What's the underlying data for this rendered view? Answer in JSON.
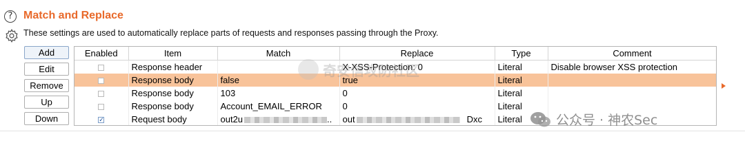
{
  "header": {
    "help_glyph": "?",
    "title": "Match and Replace",
    "description": "These settings are used to automatically replace parts of requests and responses passing through the Proxy."
  },
  "buttons": {
    "add": "Add",
    "edit": "Edit",
    "remove": "Remove",
    "up": "Up",
    "down": "Down"
  },
  "table": {
    "columns": [
      "Enabled",
      "Item",
      "Match",
      "Replace",
      "Type",
      "Comment"
    ],
    "selected_row": 1,
    "rows": [
      {
        "enabled": false,
        "item": "Response header",
        "match": "",
        "replace": "X-XSS-Protection: 0",
        "type": "Literal",
        "comment": "Disable browser XSS protection"
      },
      {
        "enabled": false,
        "item": "Response body",
        "match": "false",
        "replace": "true",
        "type": "Literal",
        "comment": ""
      },
      {
        "enabled": false,
        "item": "Response body",
        "match": "103",
        "replace": "0",
        "type": "Literal",
        "comment": ""
      },
      {
        "enabled": false,
        "item": "Response body",
        "match": "Account_EMAIL_ERROR",
        "replace": "0",
        "type": "Literal",
        "comment": ""
      },
      {
        "enabled": true,
        "item": "Request body",
        "match": "out2u",
        "match_suffix": "..",
        "replace": "out",
        "replace_suffix": "Dxc",
        "type": "Literal",
        "comment": ""
      }
    ]
  },
  "watermarks": {
    "center_text": "奇安信攻防社区",
    "corner_text": "公众号 · 神农Sec"
  },
  "colors": {
    "accent": "#e8692a",
    "selected_row": "#f8c39a",
    "checkbox_check": "#1a4f9c"
  }
}
